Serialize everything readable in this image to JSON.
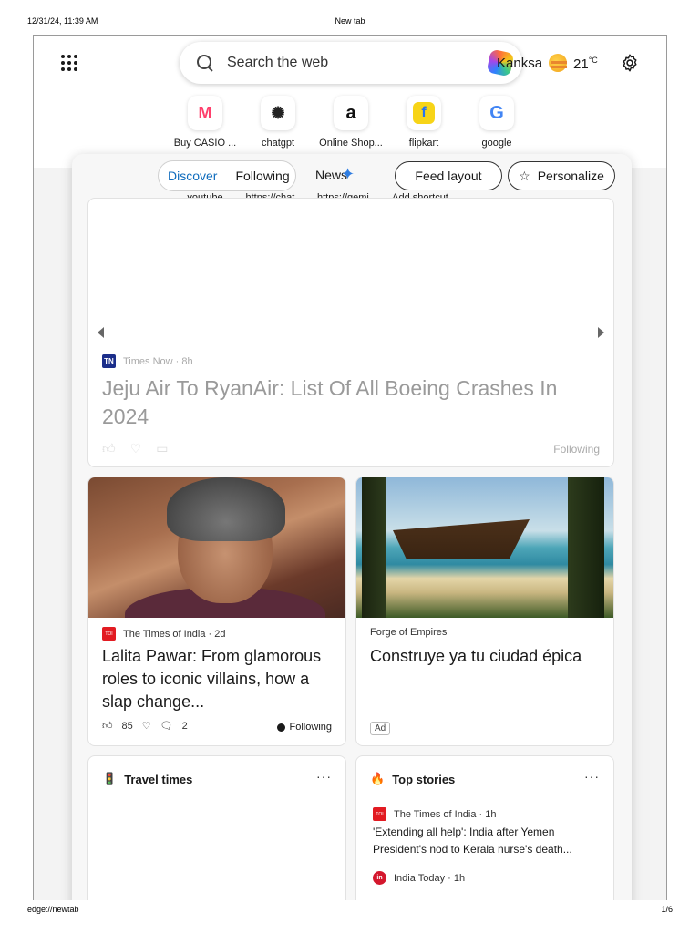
{
  "print_header": {
    "datetime": "12/31/24, 11:39 AM",
    "title": "New tab"
  },
  "print_footer": {
    "url": "edge://newtab",
    "page": "1/6"
  },
  "topbar": {
    "search_placeholder": "Search the web",
    "location": "Kanksa",
    "temperature": "21",
    "temp_unit": "°C"
  },
  "shortcuts_row1": [
    {
      "label": "Buy CASIO ...",
      "icon": "myntra-icon"
    },
    {
      "label": "chatgpt",
      "icon": "chatgpt-icon"
    },
    {
      "label": "Online Shop...",
      "icon": "amazon-icon"
    },
    {
      "label": "flipkart",
      "icon": "flipkart-icon"
    },
    {
      "label": "google",
      "icon": "google-icon"
    }
  ],
  "shortcuts_row2": [
    {
      "label": "youtube"
    },
    {
      "label": "https://chat..."
    },
    {
      "label": "https://gemi..."
    },
    {
      "label": "Add shortcut"
    }
  ],
  "feed": {
    "tabs": [
      "Discover",
      "Following",
      "News"
    ],
    "active_tab": "Discover",
    "feed_layout": "Feed layout",
    "personalize": "Personalize"
  },
  "hero": {
    "source": "Times Now",
    "age": "8h",
    "logo": "TN",
    "title": "Jeju Air To RyanAir: List Of All Boeing Crashes In 2024",
    "following": "Following"
  },
  "cards": [
    {
      "source": "The Times of India",
      "age": "2d",
      "headline": "Lalita Pawar: From glamorous roles to iconic villains, how a slap change...",
      "likes": "85",
      "comments": "2",
      "following": "Following"
    },
    {
      "source": "Forge of Empires",
      "headline": "Construye ya tu ciudad épica",
      "ad": "Ad"
    }
  ],
  "widgets": {
    "travel_title": "Travel times",
    "top_title": "Top stories",
    "top_item1_source": "The Times of India",
    "top_item1_age": "1h",
    "top_item1_headline": "'Extending all help': India after Yemen President's nod to Kerala nurse's death...",
    "top_item2_source": "India Today",
    "top_item2_age": "1h"
  },
  "colors": {
    "accent": "#0f6cbd",
    "toi_red": "#e21b22",
    "times_now_blue": "#1b2e8a"
  }
}
